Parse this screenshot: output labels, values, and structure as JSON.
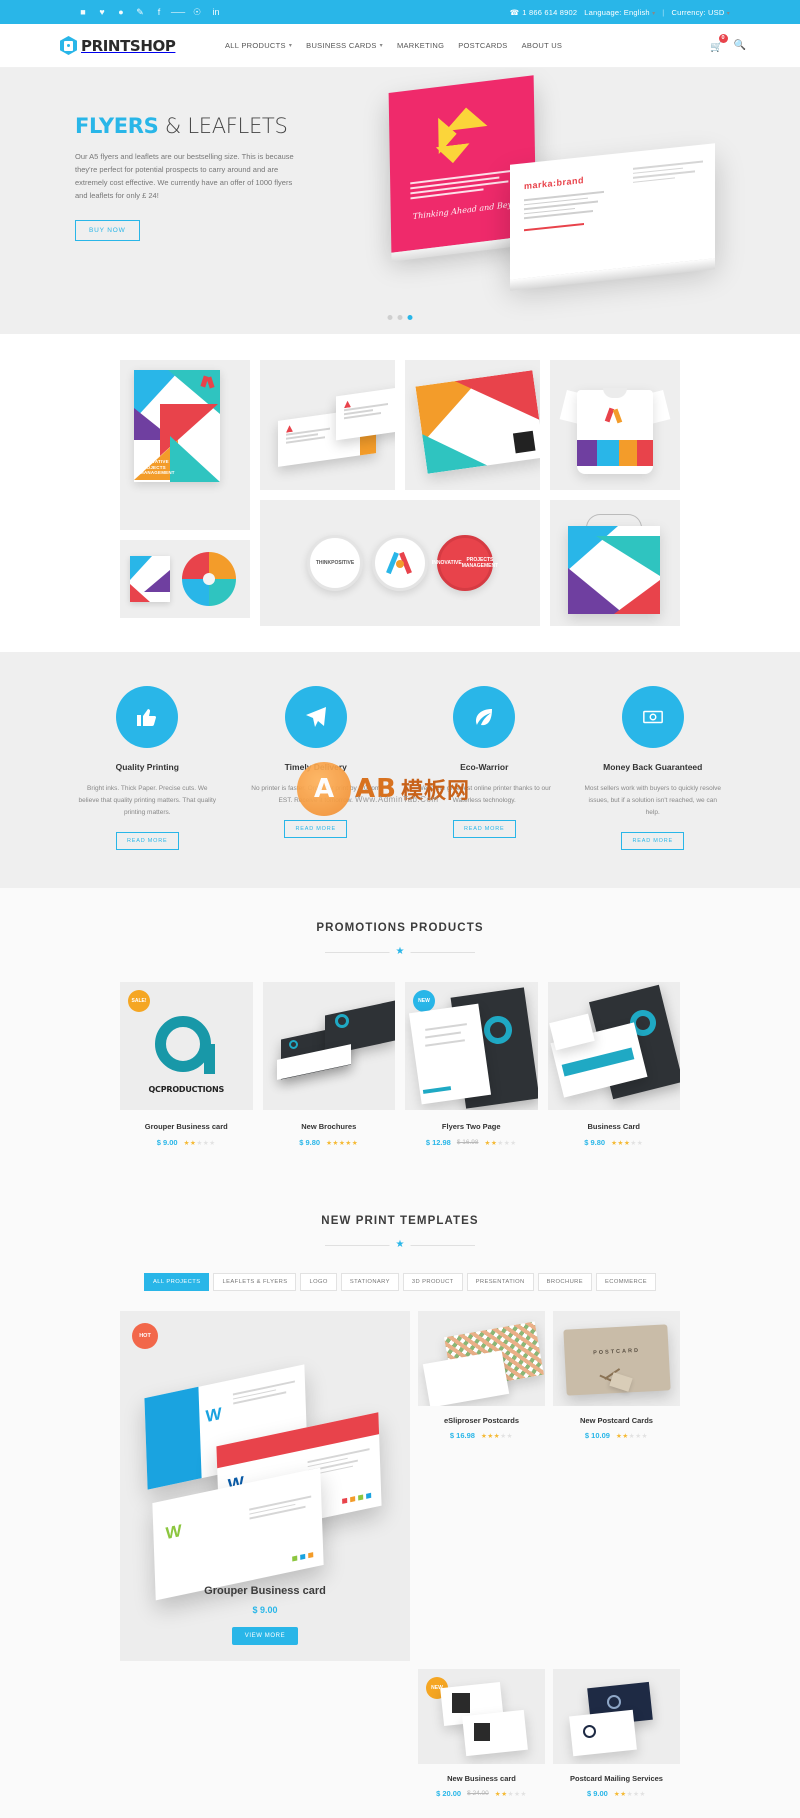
{
  "topbar": {
    "social_icons": [
      "facebook-square-icon",
      "heart-icon",
      "dribbble-icon",
      "pencil-icon",
      "facebook-icon",
      "twitter-icon",
      "pinterest-icon",
      "linkedin-icon"
    ],
    "phone": "1 866 614 8902",
    "language": "Language: English",
    "currency": "Currency: USD"
  },
  "header": {
    "logo_text": "PRINTSHOP",
    "nav": [
      {
        "label": "ALL PRODUCTS",
        "caret": true
      },
      {
        "label": "BUSINESS CARDS",
        "caret": true
      },
      {
        "label": "MARKETING",
        "caret": false
      },
      {
        "label": "POSTCARDS",
        "caret": false
      },
      {
        "label": "ABOUT US",
        "caret": false
      }
    ],
    "cart_count": "0"
  },
  "hero": {
    "title_accent": "FLYERS",
    "title_rest": " & LEAFLETS",
    "description": "Our A5 flyers and leaflets are our bestselling size. This is because they're perfect for potential prospects to carry around and are extremely cost effective. We currently have an offer of 1000 flyers and leaflets for only £ 24!",
    "cta": "BUY NOW",
    "slide_count": 3,
    "active_slide": 3,
    "pink_card_script": "Thinking Ahead and Beyond"
  },
  "gallery": {
    "poster_caption": "INNOVATIVE\nPROJECTS\nMANAGEMENT",
    "badges": [
      {
        "line1": "THINK",
        "line2": "POSITIVE",
        "style": "light"
      },
      {
        "line1": "",
        "line2": "",
        "style": "light"
      },
      {
        "line1": "INNOVATIVE",
        "line2": "PROJECTS MANAGEMENT",
        "style": "red"
      }
    ]
  },
  "services": [
    {
      "icon": "thumbs-up-icon",
      "glyph": "👍",
      "title": "Quality Printing",
      "text": "Bright inks. Thick Paper. Precise cuts. We believe that quality printing matters. That quality printing matters.",
      "button": "READ MORE"
    },
    {
      "icon": "paper-plane-icon",
      "glyph": "➤",
      "title": "Timely Delivery",
      "text": "No printer is faster. Order for print by 8:00pm EST. Receive it tomorrow.",
      "button": "READ MORE"
    },
    {
      "icon": "leaf-icon",
      "glyph": "❧",
      "title": "Eco-Warrior",
      "text": "We're the greenest online printer thanks to our Waterless technology.",
      "button": "READ MORE"
    },
    {
      "icon": "money-icon",
      "glyph": "💵",
      "title": "Money Back Guaranteed",
      "text": "Most sellers work with buyers to quickly resolve issues, but if a solution isn't reached, we can help.",
      "button": "READ MORE"
    }
  ],
  "promotions": {
    "title": "PROMOTIONS PRODUCTS",
    "products": [
      {
        "name": "Grouper Business card",
        "price": "$ 9.00",
        "old_price": "",
        "rating": 2.5,
        "badge": "SALE!",
        "badge_type": "sale",
        "brand": "QCPRODUCTIONS"
      },
      {
        "name": "New Brochures",
        "price": "$ 9.80",
        "old_price": "",
        "rating": 5,
        "badge": "",
        "badge_type": ""
      },
      {
        "name": "Flyers Two Page",
        "price": "$ 12.98",
        "old_price": "$ 16.98",
        "rating": 2.5,
        "badge": "NEW",
        "badge_type": "new"
      },
      {
        "name": "Business Card",
        "price": "$ 9.80",
        "old_price": "",
        "rating": 3.5,
        "badge": "",
        "badge_type": ""
      }
    ]
  },
  "portfolio": {
    "title": "NEW PRINT TEMPLATES",
    "filters": [
      {
        "label": "ALL PROJECTS",
        "active": true
      },
      {
        "label": "LEAFLETS & FLYERS",
        "active": false
      },
      {
        "label": "LOGO",
        "active": false
      },
      {
        "label": "STATIONARY",
        "active": false
      },
      {
        "label": "3D PRODUCT",
        "active": false
      },
      {
        "label": "PRESENTATION",
        "active": false
      },
      {
        "label": "BROCHURE",
        "active": false
      },
      {
        "label": "ECOMMERCE",
        "active": false
      }
    ],
    "featured": {
      "badge": "HOT",
      "name": "Grouper Business card",
      "price": "$ 9.00",
      "button": "VIEW MORE"
    },
    "items": [
      {
        "name": "eSliproser Postcards",
        "price": "$ 16.98",
        "old_price": "",
        "rating": 3.5,
        "badge": "",
        "badge_type": ""
      },
      {
        "name": "New Postcard Cards",
        "price": "$ 10.09",
        "old_price": "",
        "rating": 2.5,
        "badge": "",
        "badge_type": ""
      },
      {
        "name": "New Business card",
        "price": "$ 20.00",
        "old_price": "$ 24.00",
        "rating": 2.5,
        "badge": "NEW",
        "badge_type": "new"
      },
      {
        "name": "Postcard Mailing Services",
        "price": "$ 9.00",
        "old_price": "",
        "rating": 2.5,
        "badge": "",
        "badge_type": ""
      }
    ],
    "postcard_label": "POSTCARD"
  },
  "watermark": {
    "brand": "AB模板网",
    "letters": "AB",
    "cn": "模板网",
    "url": "Www.AdminTab.Com"
  },
  "colors": {
    "accent": "#29b6e8",
    "sale": "#f5a623",
    "hot": "#f2674a",
    "star": "#f5b932",
    "price": "#29b6e8"
  }
}
